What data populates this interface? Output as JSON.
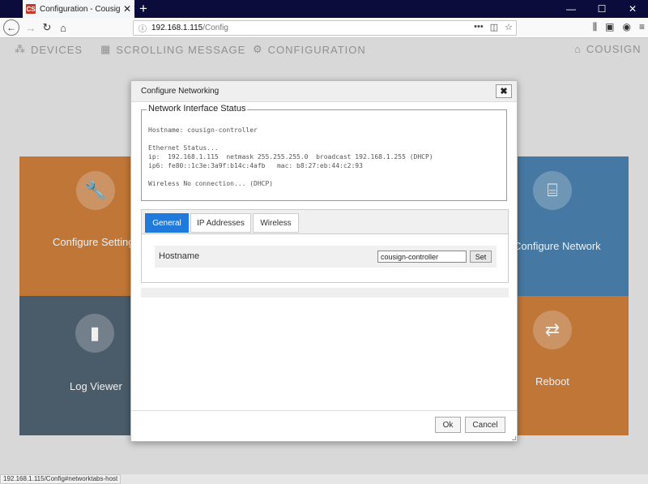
{
  "browser": {
    "tab_title": "Configuration - Cousign Netw",
    "favicon_text": "CS",
    "tab_close": "✕",
    "new_tab": "+",
    "url_host": "192.168.1.115",
    "url_path": "/Config",
    "window_buttons": [
      "—",
      "☐",
      "✕"
    ]
  },
  "app_nav": {
    "devices": "DEVICES",
    "scrolling_message": "SCROLLING MESSAGE",
    "configuration": "CONFIGURATION",
    "brand": "COUSIGN"
  },
  "tiles": {
    "settings": "Configure Settings",
    "logs": "Log Viewer",
    "network": "Configure Network",
    "reboot": "Reboot"
  },
  "dialog": {
    "title": "Configure Networking",
    "close_label": "✖",
    "legend": "Network Interface Status",
    "status_lines": {
      "hostname": "Hostname: cousign-controller",
      "eth_header": "Ethernet Status...",
      "ip": "ip:  192.168.1.115  netmask 255.255.255.0  broadcast 192.168.1.255 (DHCP)",
      "ip6": "ip6: fe80::1c3e:3a9f:b14c:4afb   mac: b8:27:eb:44:c2:93",
      "wireless": "Wireless No connection... (DHCP)"
    },
    "tabs": [
      "General",
      "IP Addresses",
      "Wireless"
    ],
    "active_tab": "General",
    "hostname_label": "Hostname",
    "hostname_value": "cousign-controller",
    "set_label": "Set",
    "ok_label": "Ok",
    "cancel_label": "Cancel"
  },
  "status_bar_url": "192.168.1.115/Config#networktabs-host",
  "colors": {
    "tile_orange": "#cc7e3a",
    "tile_slate": "#4f6170",
    "tile_blue": "#4a80ad",
    "tab_active": "#1f7adb",
    "titlebar": "#0c0c3c"
  }
}
